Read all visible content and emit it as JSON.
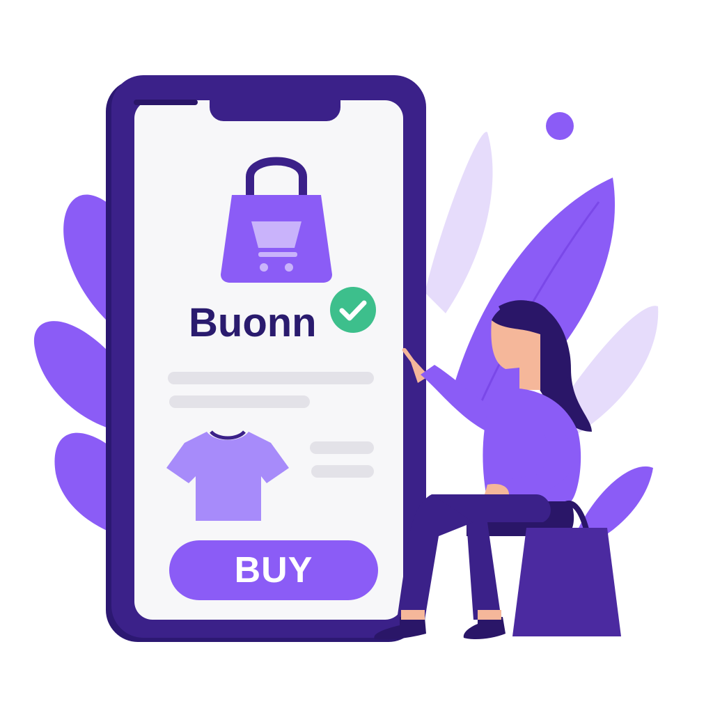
{
  "app": {
    "brand_name": "Buonn"
  },
  "product": {
    "buy_label": "BUY"
  },
  "icons": {
    "bag": "shopping-bag-icon",
    "verified": "check-circle-icon",
    "product": "tshirt-icon",
    "tote": "tote-bag-icon"
  },
  "colors": {
    "phone_frame": "#3b2189",
    "accent": "#8b5cf6",
    "brand_text": "#2a1b6e",
    "verified": "#3dbf8c",
    "leaf_dark": "#8b5cf6",
    "leaf_light": "#e6dcfb"
  }
}
